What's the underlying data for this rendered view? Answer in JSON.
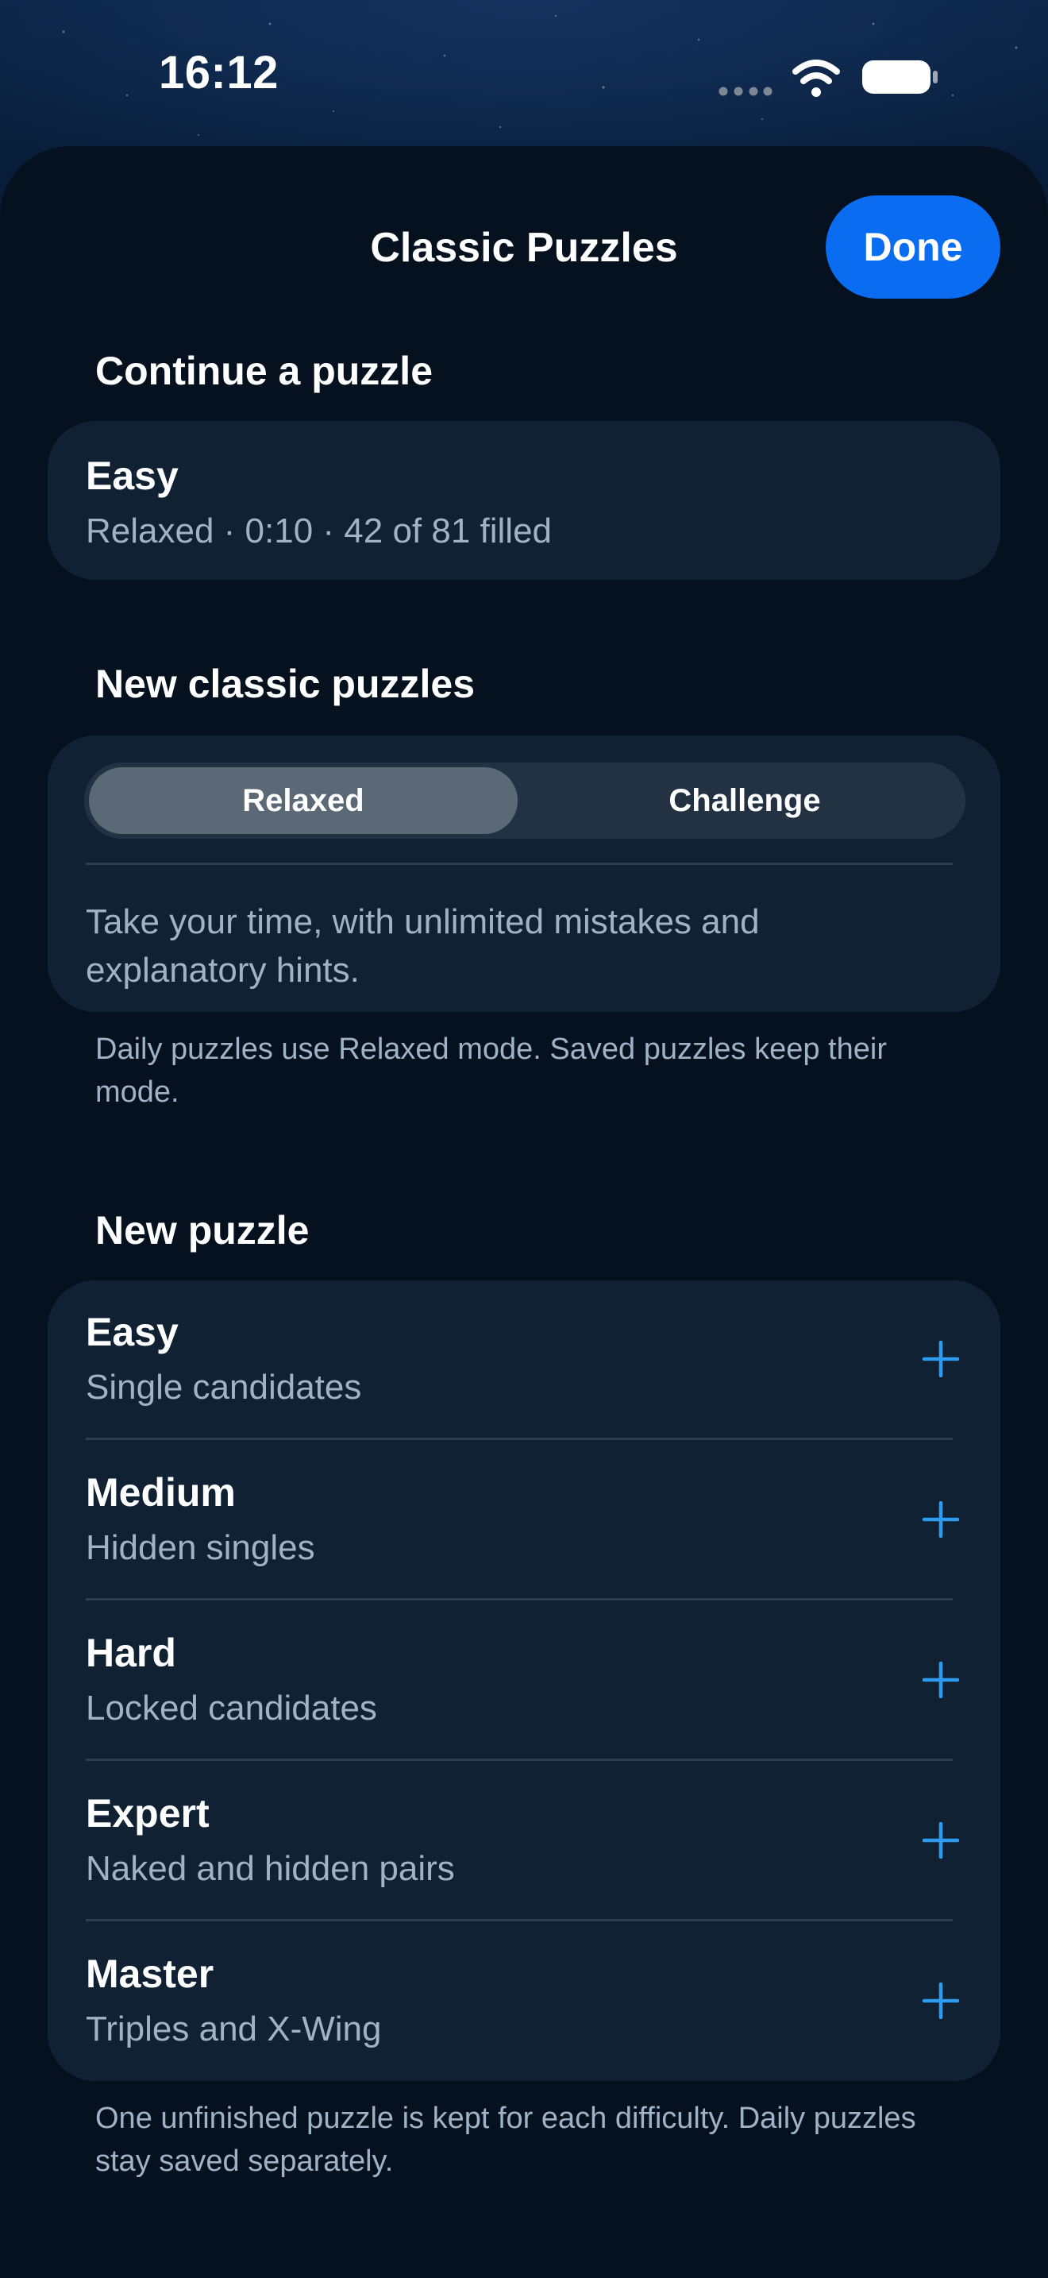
{
  "status_bar": {
    "time": "16:12",
    "icons": [
      "signal-dots-icon",
      "wifi-icon",
      "battery-icon"
    ]
  },
  "sheet": {
    "title": "Classic Puzzles",
    "done_label": "Done"
  },
  "continue_section": {
    "header": "Continue a puzzle",
    "item": {
      "title": "Easy",
      "subtitle": "Relaxed · 0:10 · 42 of 81 filled"
    }
  },
  "classic_section": {
    "header": "New classic puzzles",
    "modes": [
      "Relaxed",
      "Challenge"
    ],
    "selected_mode": "Relaxed",
    "description": "Take your time, with unlimited mistakes and explanatory hints.",
    "footnote": "Daily puzzles use Relaxed mode. Saved puzzles keep their mode."
  },
  "new_puzzle_section": {
    "header": "New puzzle",
    "items": [
      {
        "title": "Easy",
        "subtitle": "Single candidates",
        "icon": "plus-icon"
      },
      {
        "title": "Medium",
        "subtitle": "Hidden singles",
        "icon": "plus-icon"
      },
      {
        "title": "Hard",
        "subtitle": "Locked candidates",
        "icon": "plus-icon"
      },
      {
        "title": "Expert",
        "subtitle": "Naked and hidden pairs",
        "icon": "plus-icon"
      },
      {
        "title": "Master",
        "subtitle": "Triples and X-Wing",
        "icon": "plus-icon"
      }
    ],
    "footnote": "One unfinished puzzle is kept for each difficulty. Daily puzzles stay saved separately."
  },
  "colors": {
    "accent": "#0a6cf0",
    "plus": "#2c9bf0",
    "card": "#0f2133",
    "sheet": "#06111f",
    "secondary_text": "#9fb2c6"
  }
}
